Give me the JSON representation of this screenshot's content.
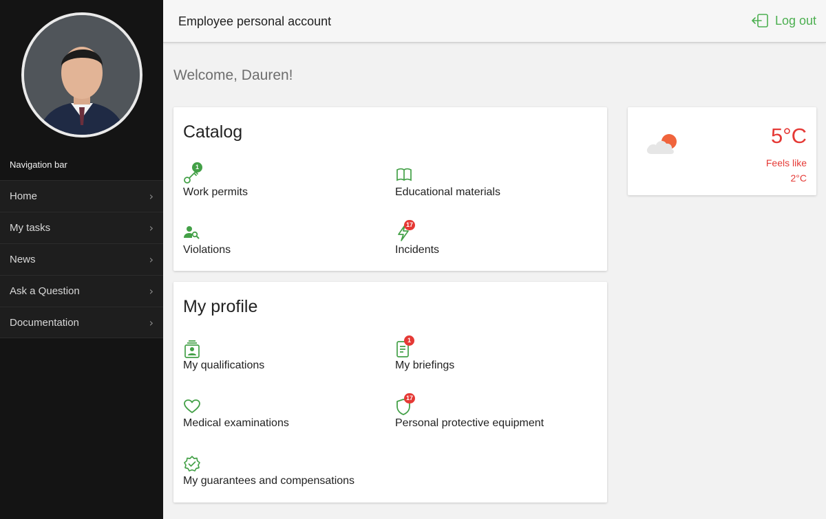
{
  "colors": {
    "accent": "#4caf50",
    "danger": "#e53935",
    "sidebar_bg": "#141414"
  },
  "sidebar": {
    "title": "Navigation bar",
    "items": [
      {
        "label": "Home"
      },
      {
        "label": "My tasks"
      },
      {
        "label": "News"
      },
      {
        "label": "Ask a Question"
      },
      {
        "label": "Documentation"
      }
    ]
  },
  "header": {
    "title": "Employee personal account",
    "logout_label": "Log out"
  },
  "welcome": "Welcome, Dauren!",
  "catalog": {
    "title": "Catalog",
    "items": [
      {
        "label": "Work permits",
        "icon": "key-icon",
        "badge": "1"
      },
      {
        "label": "Educational materials",
        "icon": "book-icon"
      },
      {
        "label": "Violations",
        "icon": "person-search-icon"
      },
      {
        "label": "Incidents",
        "icon": "lightning-icon",
        "badge": "17"
      }
    ]
  },
  "profile": {
    "title": "My profile",
    "items": [
      {
        "label": "My qualifications",
        "icon": "id-badge-icon"
      },
      {
        "label": "My briefings",
        "icon": "document-icon",
        "badge": "1"
      },
      {
        "label": "Medical examinations",
        "icon": "heart-icon"
      },
      {
        "label": "Personal protective equipment",
        "icon": "shield-icon",
        "badge": "17"
      },
      {
        "label": "My guarantees and compensations",
        "icon": "verified-icon"
      }
    ]
  },
  "weather": {
    "temperature": "5°C",
    "feels_like_label": "Feels like",
    "feels_like_value": "2°C",
    "icon": "cloud-sun-icon"
  }
}
